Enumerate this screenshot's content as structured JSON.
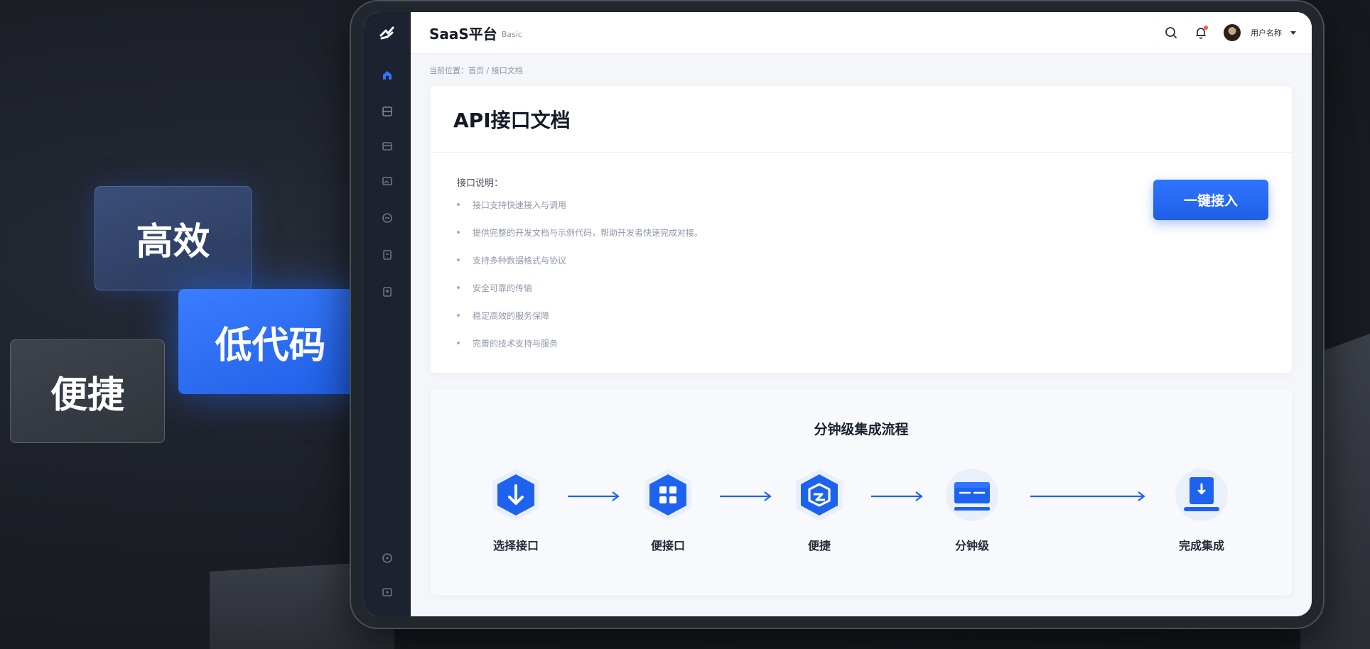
{
  "tags": {
    "gaoxiao": "高效",
    "didaima": "低代码",
    "bianjie": "便捷"
  },
  "header": {
    "brand": "SaaS平台",
    "brand_sub": "Basic",
    "user_name": "用户名称"
  },
  "breadcrumb": "当前位置：首页 / 接口文档",
  "doc": {
    "title": "API接口文档",
    "section_label": "接口说明：",
    "bullets": [
      "接口支持快速接入与调用",
      "提供完整的开发文档与示例代码，帮助开发者快速完成对接。",
      "支持多种数据格式与协议",
      "安全可靠的传输",
      "稳定高效的服务保障",
      "完善的技术支持与服务"
    ],
    "cta_label": "一键接入"
  },
  "flow": {
    "title": "分钟级集成流程",
    "steps": [
      {
        "label": "选择接口",
        "icon": "download-arrow-icon"
      },
      {
        "label": "便接口",
        "icon": "grid-apps-icon"
      },
      {
        "label": "便捷",
        "icon": "box-package-icon"
      },
      {
        "label": "分钟级",
        "icon": "monitor-config-icon"
      },
      {
        "label": "完成集成",
        "icon": "laptop-download-icon"
      }
    ]
  },
  "colors": {
    "accent": "#1f5fe6",
    "sidebar": "#1d2230",
    "icon_blue": "#1e63f0"
  }
}
